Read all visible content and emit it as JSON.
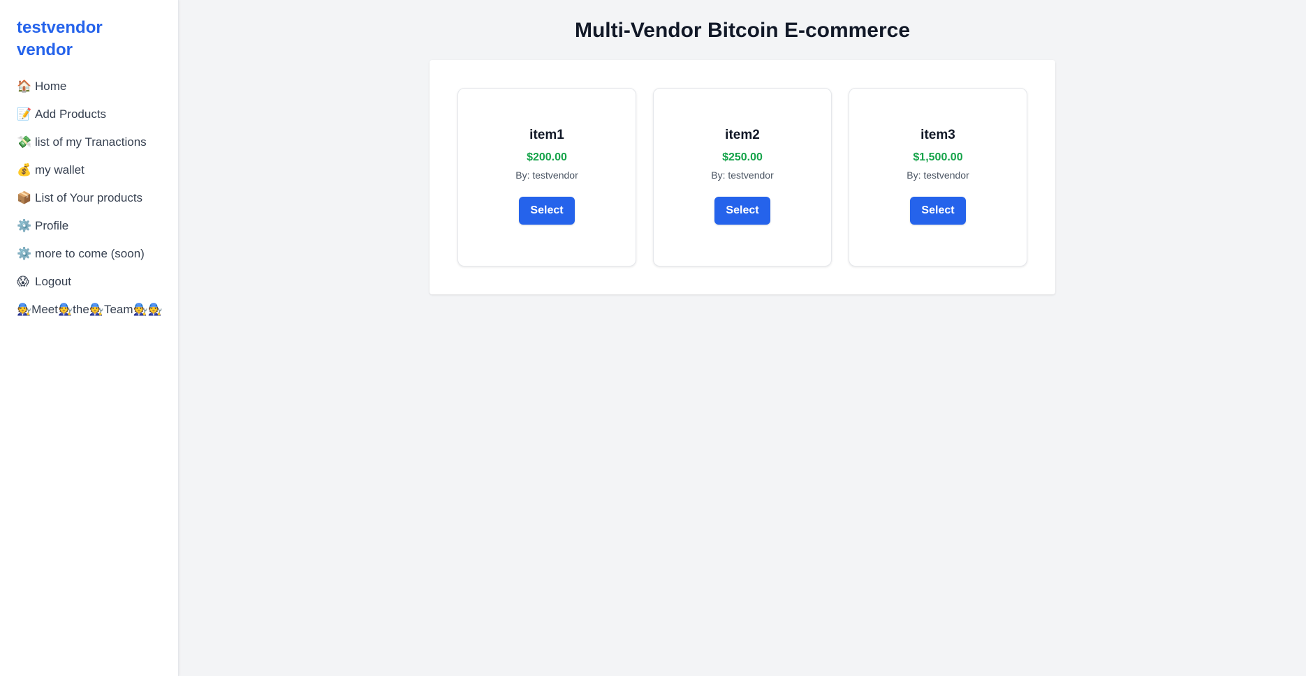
{
  "sidebar": {
    "brand": "testvendor vendor",
    "items": [
      {
        "icon": "🏠",
        "icon_name": "home-icon",
        "label": "Home"
      },
      {
        "icon": "📝",
        "icon_name": "memo-icon",
        "label": "Add Products"
      },
      {
        "icon": "💸",
        "icon_name": "money-wings-icon",
        "label": "list of my Tranactions"
      },
      {
        "icon": "💰",
        "icon_name": "money-bag-icon",
        "label": "my wallet"
      },
      {
        "icon": "📦",
        "icon_name": "package-icon",
        "label": "List of Your products"
      },
      {
        "icon": "⚙️",
        "icon_name": "gear-icon",
        "label": "Profile"
      },
      {
        "icon": "⚙️",
        "icon_name": "gear-icon",
        "label": "more to come (soon)"
      },
      {
        "icon": "😱",
        "icon_name": "screaming-face-icon",
        "label": "Logout"
      }
    ],
    "team": {
      "icon": "🧑‍🔧",
      "icon_name": "mechanic-icon",
      "words": [
        "Meet",
        "the",
        "Team"
      ]
    }
  },
  "main": {
    "title": "Multi-Vendor Bitcoin E-commerce",
    "products": [
      {
        "name": "item1",
        "price": "$200.00",
        "vendor": "By: testvendor",
        "button": "Select"
      },
      {
        "name": "item2",
        "price": "$250.00",
        "vendor": "By: testvendor",
        "button": "Select"
      },
      {
        "name": "item3",
        "price": "$1,500.00",
        "vendor": "By: testvendor",
        "button": "Select"
      }
    ]
  },
  "colors": {
    "accent": "#2563eb",
    "price": "#16a34a",
    "background": "#f3f4f6"
  }
}
